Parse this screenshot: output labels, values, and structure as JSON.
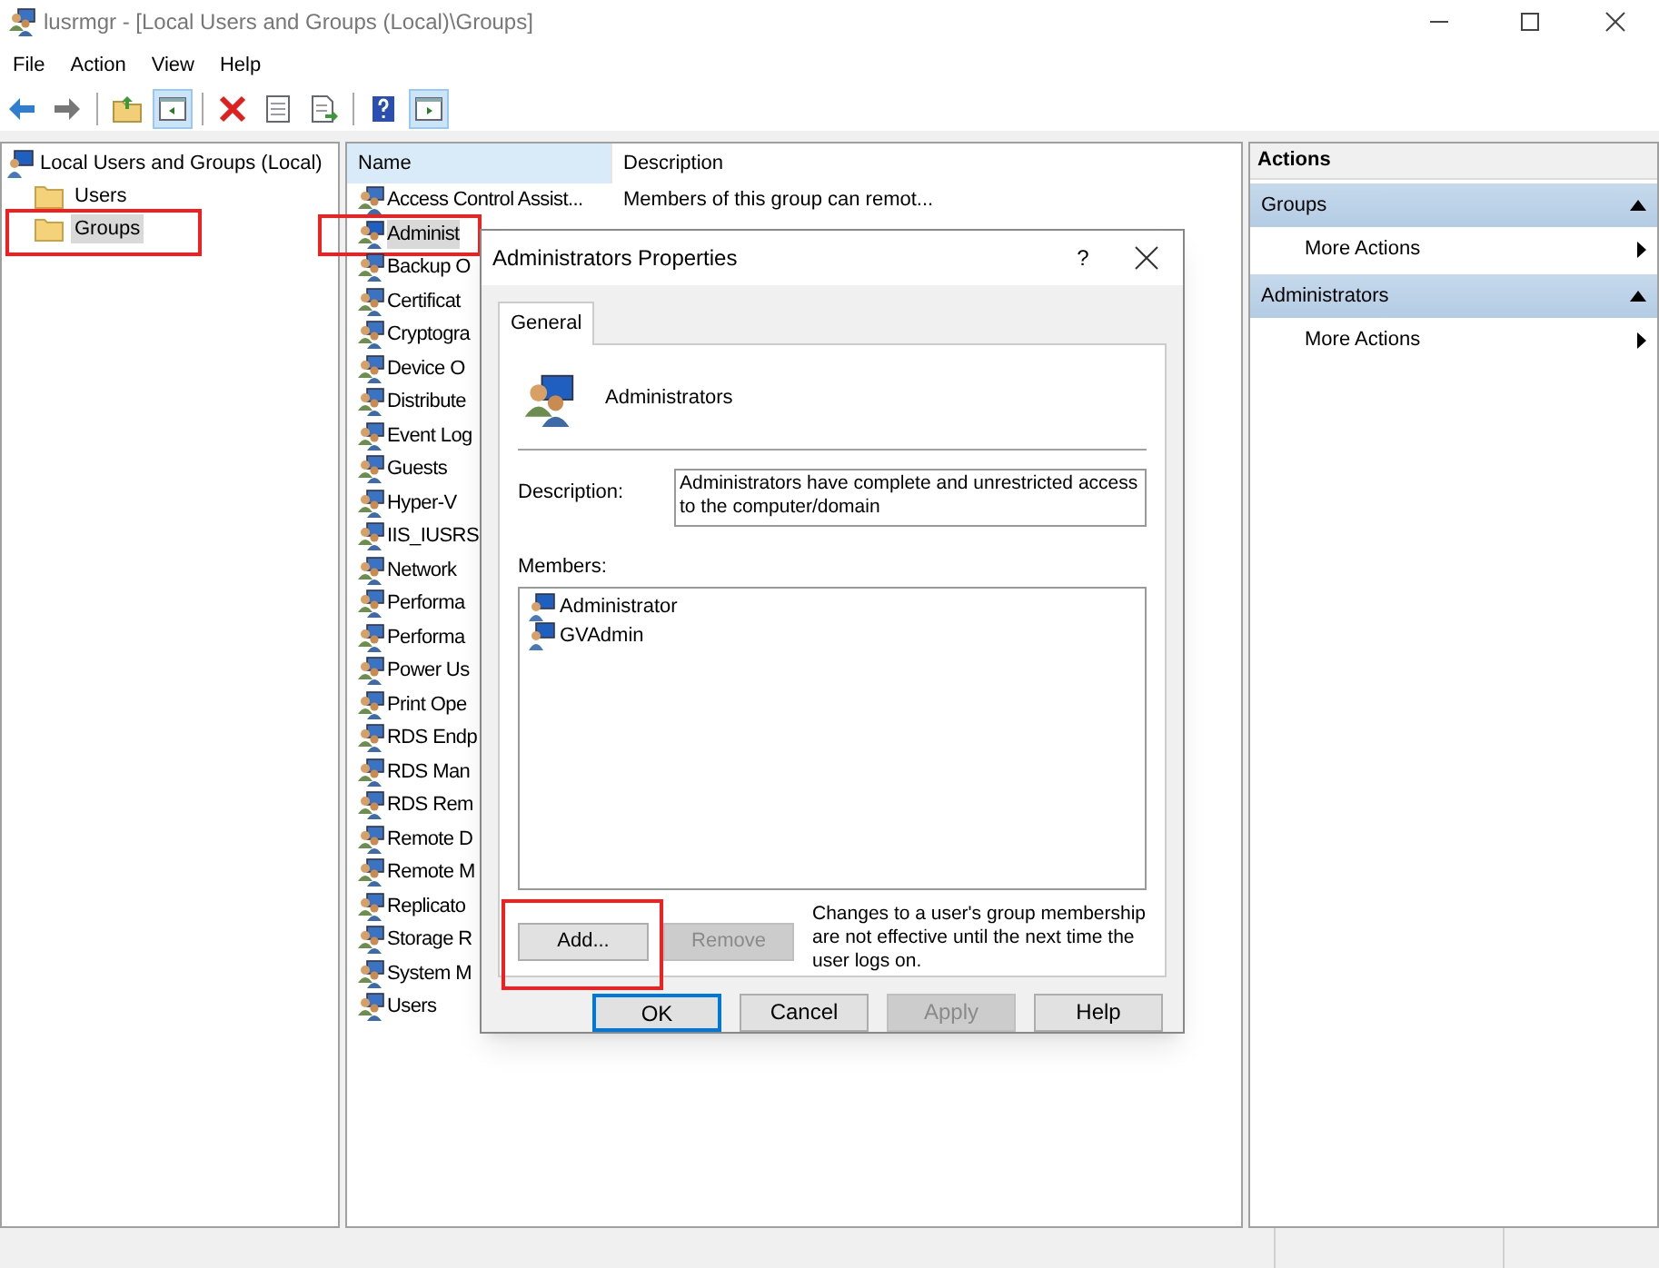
{
  "window": {
    "title": "lusrmgr - [Local Users and Groups (Local)\\Groups]"
  },
  "menu": [
    "File",
    "Action",
    "View",
    "Help"
  ],
  "toolbar": [
    {
      "kind": "back",
      "pressed": false
    },
    {
      "kind": "forward",
      "pressed": false
    },
    {
      "kind": "sep"
    },
    {
      "kind": "up",
      "pressed": false
    },
    {
      "kind": "tree",
      "pressed": true
    },
    {
      "kind": "sep"
    },
    {
      "kind": "delete",
      "pressed": false
    },
    {
      "kind": "properties",
      "pressed": false
    },
    {
      "kind": "export",
      "pressed": false
    },
    {
      "kind": "sep"
    },
    {
      "kind": "help",
      "pressed": false
    },
    {
      "kind": "pane",
      "pressed": true
    }
  ],
  "tree": {
    "label": "Local Users and Groups (Local)",
    "children": [
      {
        "label": "Users",
        "selected": false,
        "highlighted": false
      },
      {
        "label": "Groups",
        "selected": true,
        "highlighted": true
      }
    ]
  },
  "list": {
    "columns": [
      "Name",
      "Description"
    ],
    "rows": [
      {
        "name": "Access Control Assist...",
        "description": "Members of this group can remot...",
        "selected": false,
        "highlighted": false
      },
      {
        "name": "Administ",
        "selected": true,
        "highlighted": true
      },
      {
        "name": "Backup O",
        "selected": false,
        "highlighted": false
      },
      {
        "name": "Certificat",
        "selected": false,
        "highlighted": false
      },
      {
        "name": "Cryptogra",
        "selected": false,
        "highlighted": false
      },
      {
        "name": "Device O",
        "selected": false,
        "highlighted": false
      },
      {
        "name": "Distribute",
        "selected": false,
        "highlighted": false
      },
      {
        "name": "Event Log",
        "selected": false,
        "highlighted": false
      },
      {
        "name": "Guests",
        "selected": false,
        "highlighted": false
      },
      {
        "name": "Hyper-V",
        "selected": false,
        "highlighted": false
      },
      {
        "name": "IIS_IUSRS",
        "selected": false,
        "highlighted": false
      },
      {
        "name": "Network",
        "selected": false,
        "highlighted": false
      },
      {
        "name": "Performa",
        "selected": false,
        "highlighted": false
      },
      {
        "name": "Performa",
        "selected": false,
        "highlighted": false
      },
      {
        "name": "Power Us",
        "selected": false,
        "highlighted": false
      },
      {
        "name": "Print Ope",
        "selected": false,
        "highlighted": false
      },
      {
        "name": "RDS Endp",
        "selected": false,
        "highlighted": false
      },
      {
        "name": "RDS Man",
        "selected": false,
        "highlighted": false
      },
      {
        "name": "RDS Rem",
        "selected": false,
        "highlighted": false
      },
      {
        "name": "Remote D",
        "selected": false,
        "highlighted": false
      },
      {
        "name": "Remote M",
        "selected": false,
        "highlighted": false
      },
      {
        "name": "Replicato",
        "selected": false,
        "highlighted": false
      },
      {
        "name": "Storage R",
        "selected": false,
        "highlighted": false
      },
      {
        "name": "System M",
        "selected": false,
        "highlighted": false
      },
      {
        "name": "Users",
        "selected": false,
        "highlighted": false
      }
    ]
  },
  "actions": {
    "title": "Actions",
    "sections": [
      {
        "title": "Groups",
        "expanded": true,
        "items": [
          "More Actions"
        ]
      },
      {
        "title": "Administrators",
        "expanded": true,
        "items": [
          "More Actions"
        ]
      }
    ]
  },
  "dialog": {
    "title": "Administrators Properties",
    "help": "?",
    "tabs": [
      {
        "label": "General",
        "selected": true
      }
    ],
    "group_name": "Administrators",
    "description_label": "Description:",
    "description": "Administrators have complete and unrestricted access to the computer/domain",
    "members_label": "Members:",
    "members": [
      "Administrator",
      "GVAdmin"
    ],
    "member_buttons": [
      {
        "label": "Add...",
        "disabled": false,
        "highlighted": true
      },
      {
        "label": "Remove",
        "disabled": true,
        "highlighted": false
      }
    ],
    "note": "Changes to a user's group membership are not effective until the next time the user logs on.",
    "buttons": [
      {
        "label": "OK",
        "disabled": false,
        "default": true
      },
      {
        "label": "Cancel",
        "disabled": false,
        "default": false
      },
      {
        "label": "Apply",
        "disabled": true,
        "default": false
      },
      {
        "label": "Help",
        "disabled": false,
        "default": false
      }
    ]
  }
}
